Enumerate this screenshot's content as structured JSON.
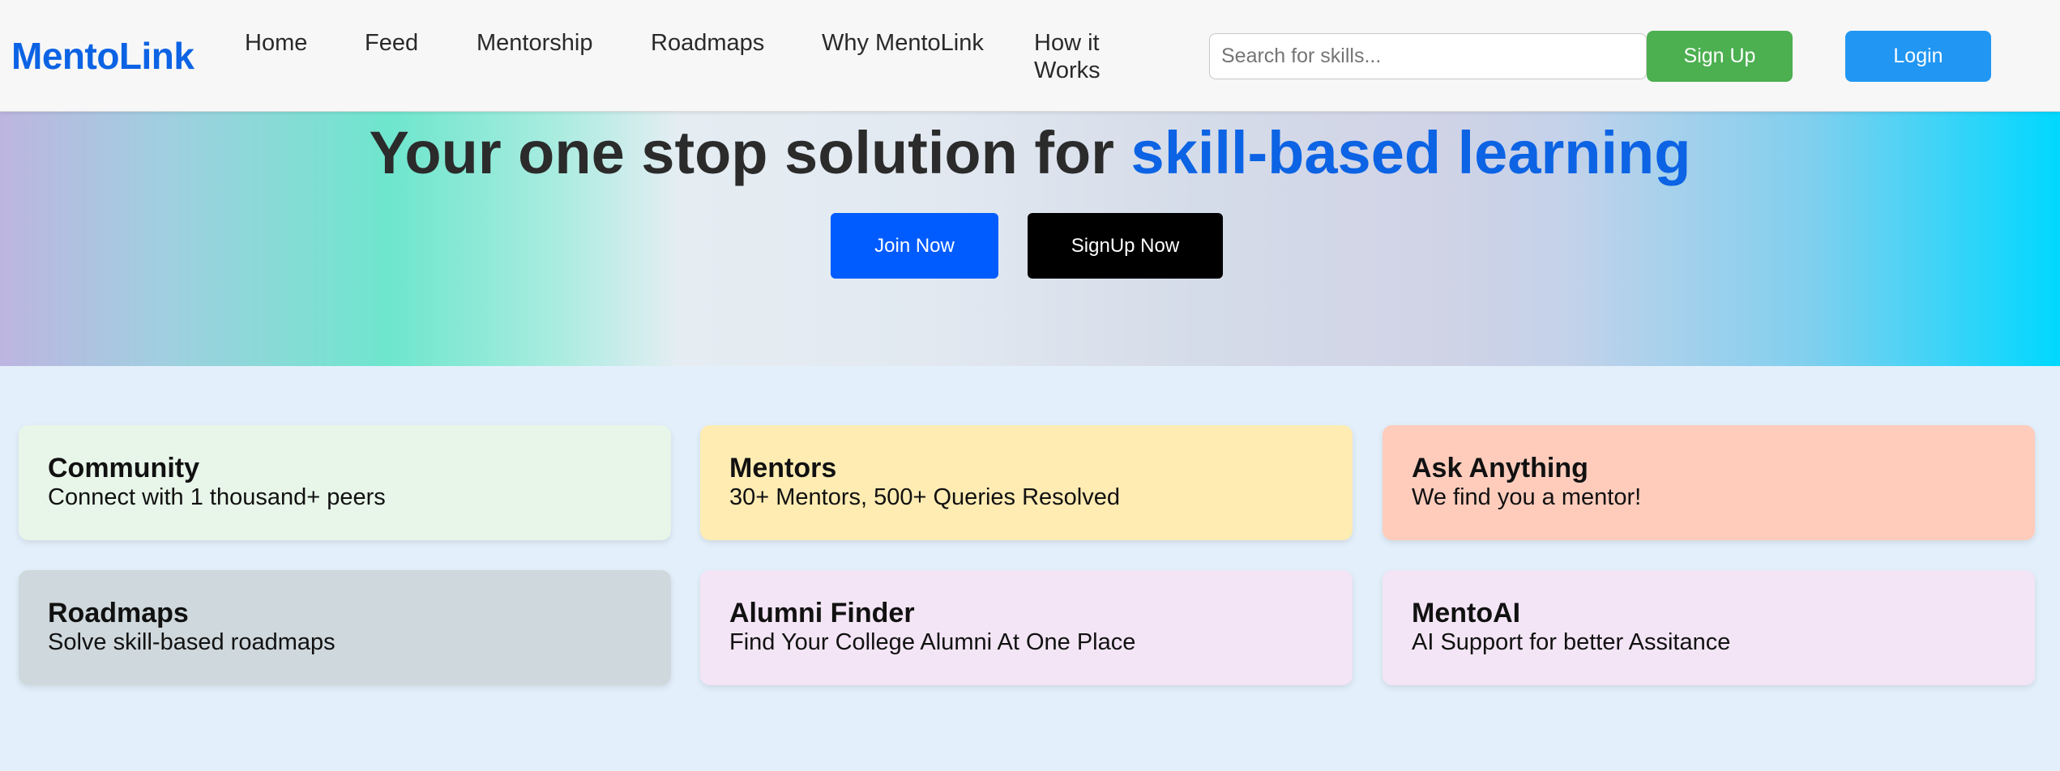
{
  "navbar": {
    "brand": "MentoLink",
    "links": {
      "home": "Home",
      "feed": "Feed",
      "mentorship": "Mentorship",
      "roadmaps": "Roadmaps",
      "why": "Why MentoLink",
      "how": "How it Works"
    },
    "search": {
      "placeholder": "Search for skills...",
      "value": ""
    },
    "signup_label": "Sign Up",
    "login_label": "Login"
  },
  "hero": {
    "title_prefix": "Your one stop solution for ",
    "title_accent": "skill-based learning",
    "join_label": "Join Now",
    "signup_now_label": "SignUp Now"
  },
  "cards": [
    {
      "title": "Community",
      "desc": "Connect with 1 thousand+ peers",
      "color": "#e8f5e9"
    },
    {
      "title": "Mentors",
      "desc": "30+ Mentors, 500+ Queries Resolved",
      "color": "#ffecb3"
    },
    {
      "title": "Ask Anything",
      "desc": "We find you a mentor!",
      "color": "#ffccbc"
    },
    {
      "title": "Roadmaps",
      "desc": "Solve skill-based roadmaps",
      "color": "#cfd8dc"
    },
    {
      "title": "Alumni Finder",
      "desc": "Find Your College Alumni At One Place",
      "color": "#f3e5f5"
    },
    {
      "title": "MentoAI",
      "desc": "AI Support for better Assitance",
      "color": "#f3e5f5"
    }
  ],
  "colors": {
    "brand": "#0c63e4",
    "signup_button": "#4caf50",
    "login_button": "#2196f3",
    "join_button": "#005cff",
    "signup_now_button": "#000000"
  }
}
